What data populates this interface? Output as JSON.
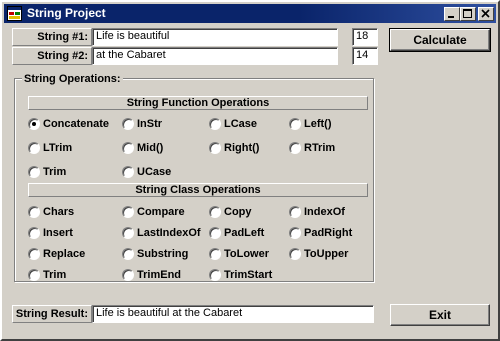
{
  "window": {
    "title": "String Project"
  },
  "inputs": {
    "string1": {
      "label": "String #1:",
      "value": "Life is beautiful",
      "length": "18"
    },
    "string2": {
      "label": "String #2:",
      "value": "at the Cabaret",
      "length": "14"
    }
  },
  "buttons": {
    "calculate": "Calculate",
    "exit": "Exit"
  },
  "operations": {
    "group_label": "String Operations:",
    "function_section": "String Function Operations",
    "class_section": "String Class Operations",
    "function_ops": [
      "Concatenate",
      "InStr",
      "LCase",
      "Left()",
      "LTrim",
      "Mid()",
      "Right()",
      "RTrim",
      "Trim",
      "UCase"
    ],
    "class_ops": [
      "Chars",
      "Compare",
      "Copy",
      "IndexOf",
      "Insert",
      "LastIndexOf",
      "PadLeft",
      "PadRight",
      "Replace",
      "Substring",
      "ToLower",
      "ToUpper",
      "Trim",
      "TrimEnd",
      "TrimStart"
    ],
    "selected": "Concatenate"
  },
  "result": {
    "label": "String Result:",
    "value": "Life is beautiful at the Cabaret"
  },
  "icons": {
    "app": "app-window-icon",
    "minimize": "minimize-icon",
    "maximize": "maximize-icon",
    "close": "close-icon"
  }
}
